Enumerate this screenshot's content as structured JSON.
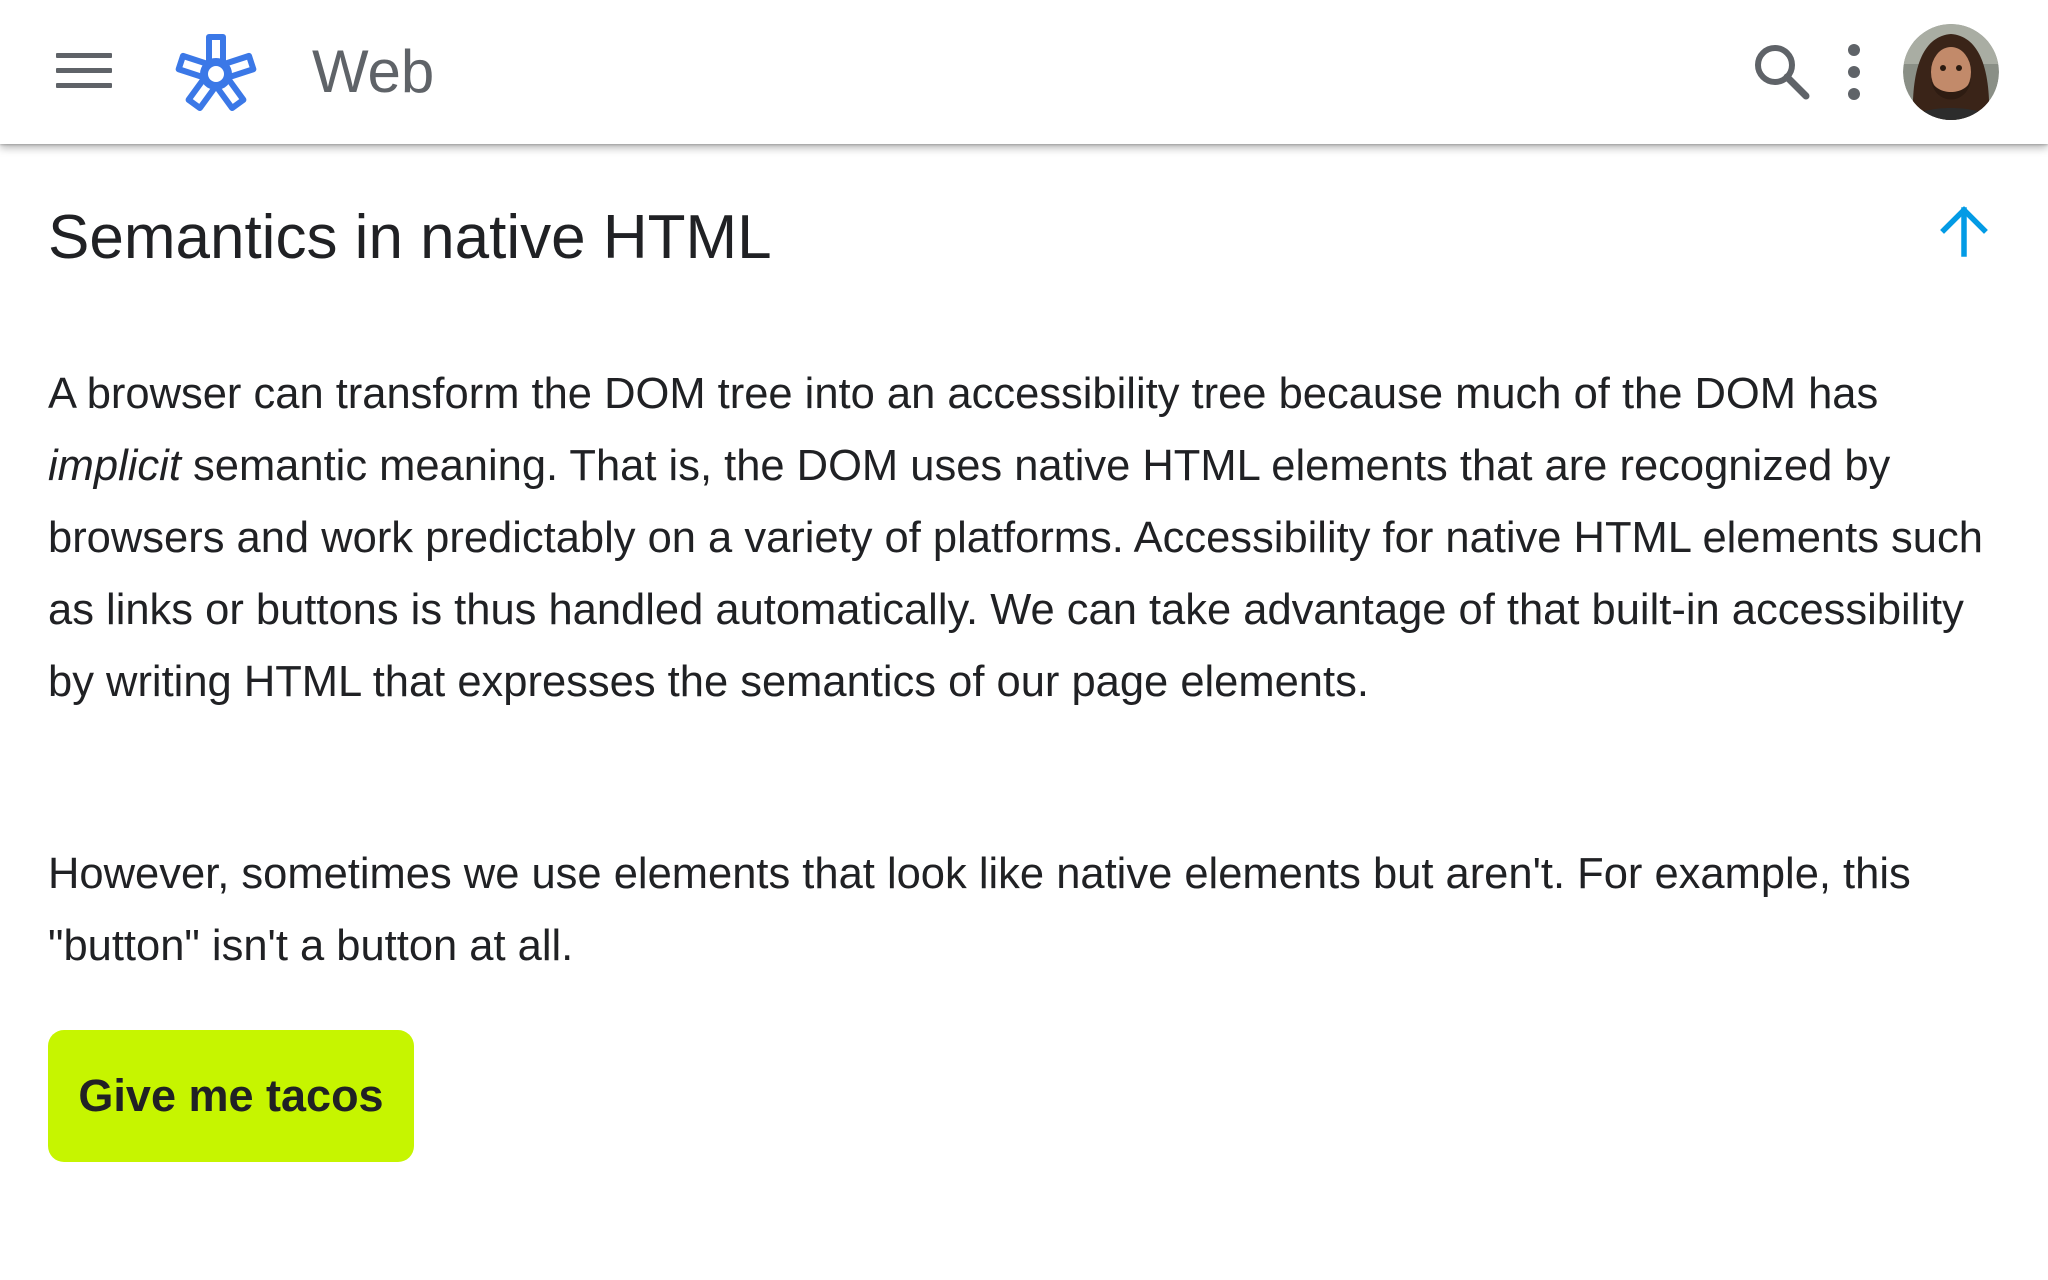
{
  "colors": {
    "accent_blue": "#3b78e7",
    "arrow_blue": "#039be5",
    "taco_button": "#c6f500",
    "text": "#202124",
    "icon_gray": "#5f6368"
  },
  "appbar": {
    "menu_icon": "hamburger-menu-icon",
    "logo_icon": "asterisk-logo-icon",
    "title": "Web",
    "search_icon": "search-icon",
    "more_icon": "more-vert-icon",
    "avatar_icon": "user-avatar"
  },
  "main": {
    "heading": "Semantics in native HTML",
    "back_to_top_icon": "arrow-upward-icon",
    "paragraph1": {
      "before": "A browser can transform the DOM tree into an accessibility tree because much of the DOM has ",
      "emphasis": "implicit",
      "after": " semantic meaning. That is, the DOM uses native HTML elements that are recognized by browsers and work predictably on a variety of platforms. Accessibility for native HTML elements such as links or buttons is thus handled automatically. We can take advantage of that built-in accessibility by writing HTML that expresses the semantics of our page elements."
    },
    "paragraph2": "However, sometimes we use elements that look like native elements but aren't. For example, this \"button\" isn't a button at all.",
    "fake_button_label": "Give me tacos"
  }
}
